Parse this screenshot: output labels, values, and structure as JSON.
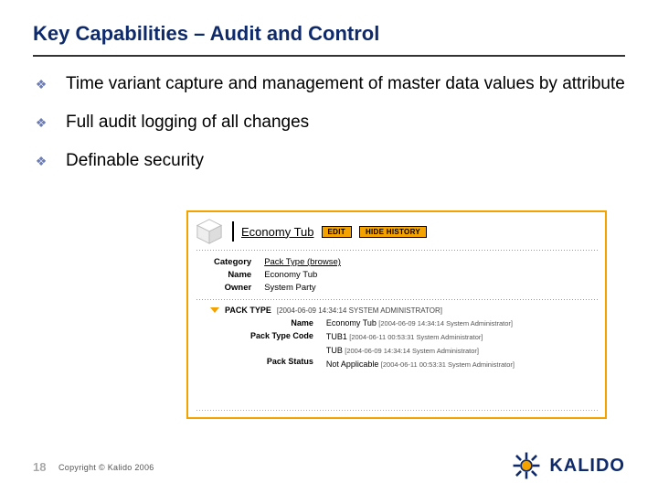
{
  "slide": {
    "title": "Key Capabilities – Audit and Control",
    "bullets": [
      "Time variant capture and management of master data values by attribute",
      "Full audit logging of all changes",
      "Definable security"
    ]
  },
  "panel": {
    "breadcrumb": "Economy Tub",
    "buttons": {
      "edit": "EDIT",
      "hide_history": "HIDE HISTORY"
    },
    "header_labels": {
      "category": "Category",
      "name": "Name",
      "owner": "Owner"
    },
    "header_values": {
      "category_link": "Pack Type (browse)",
      "name": "Economy Tub",
      "owner": "System Party"
    },
    "section": {
      "title": "PACK TYPE",
      "meta": "[2004-06-09 14:34:14 SYSTEM ADMINISTRATOR]"
    },
    "detail_labels": {
      "name": "Name",
      "code": "Pack Type Code",
      "status": "Pack Status"
    },
    "detail_values": {
      "name_primary": "Economy Tub",
      "name_meta": "[2004-06-09 14:34:14 System Administrator]",
      "code_primary": "TUB1",
      "code_meta": "[2004-06-11 00:53:31 System Administrator]",
      "code_extra": "TUB",
      "code_extra_meta": "[2004-06-09 14:34:14 System Administrator]",
      "status_primary": "Not Applicable",
      "status_meta": "[2004-06-11 00:53:31 System Administrator]"
    }
  },
  "footer": {
    "page": "18",
    "copyright": "Copyright © Kalido 2006",
    "brand": "KALIDO"
  },
  "colors": {
    "accent": "#f3a200",
    "title": "#0f2a6a"
  }
}
